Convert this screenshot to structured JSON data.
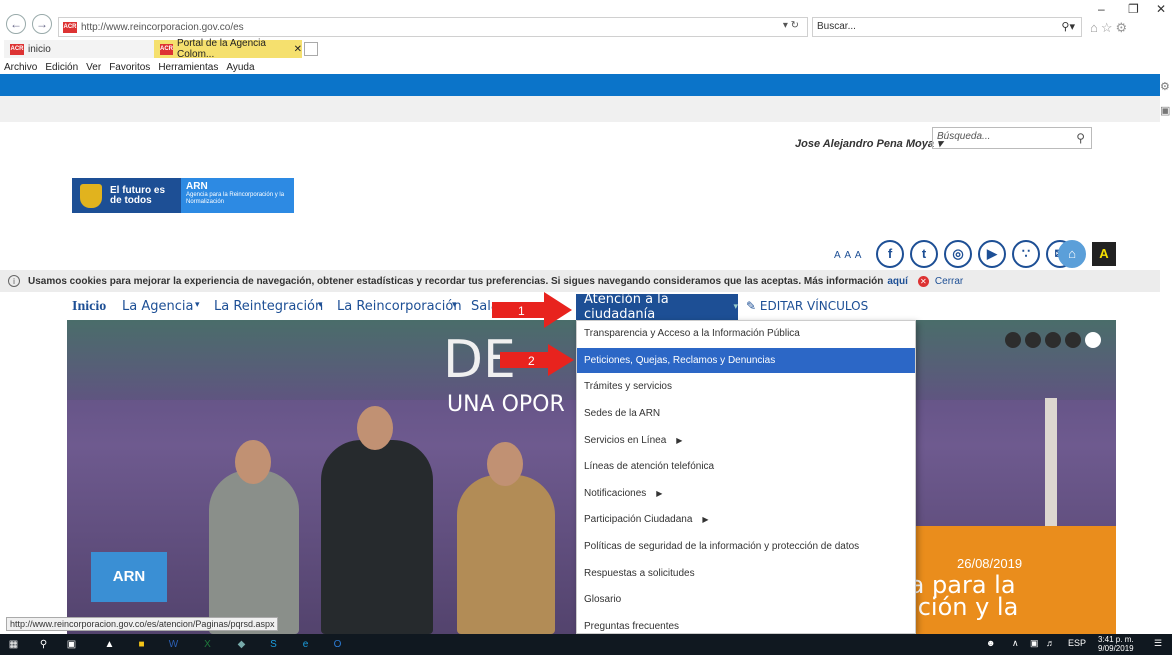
{
  "browser": {
    "url": "http://www.reincorporacion.gov.co/es",
    "favicon_text": "ACR",
    "search_placeholder": "Buscar...",
    "tabs": [
      {
        "label": "inicio"
      },
      {
        "label": "Portal de la Agencia Colom..."
      }
    ],
    "menu": [
      "Archivo",
      "Edición",
      "Ver",
      "Favoritos",
      "Herramientas",
      "Ayuda"
    ],
    "status_url": "http://www.reincorporacion.gov.co/es/atencion/Paginas/pqrsd.aspx"
  },
  "site": {
    "user_name": "Jose Alejandro Pena Moya",
    "search_placeholder": "Búsqueda...",
    "logo": {
      "left": "El futuro es de todos",
      "right_title": "ARN",
      "right_sub": "Agencia para la Reincorporación y la Normalización"
    },
    "font_size_label": "A A A",
    "contrast_label": "A",
    "social_icons": [
      "facebook-icon",
      "twitter-icon",
      "instagram-icon",
      "youtube-icon",
      "rss-icon",
      "email-icon",
      "home-icon"
    ],
    "cookie": {
      "text": "Usamos cookies para mejorar la experiencia de navegación, obtener estadísticas y recordar tus preferencias. Si sigues navegando consideramos que las aceptas. Más información",
      "link": "aquí",
      "close": "Cerrar"
    },
    "nav": {
      "home": "Inicio",
      "items": [
        "La Agencia",
        "La Reintegración",
        "La Reincorporación",
        "Sala"
      ],
      "active": "Atención a la ciudadanía",
      "edit": "EDITAR VÍNCULOS"
    },
    "dropdown": [
      {
        "label": "Transparencia y Acceso a la Información Pública",
        "submenu": false,
        "selected": false
      },
      {
        "label": "Peticiones, Quejas, Reclamos y Denuncias",
        "submenu": false,
        "selected": true
      },
      {
        "label": "Trámites y servicios",
        "submenu": false,
        "selected": false
      },
      {
        "label": "Sedes de la ARN",
        "submenu": false,
        "selected": false
      },
      {
        "label": "Servicios en Línea",
        "submenu": true,
        "selected": false
      },
      {
        "label": "Líneas de atención telefónica",
        "submenu": false,
        "selected": false
      },
      {
        "label": "Notificaciones",
        "submenu": true,
        "selected": false
      },
      {
        "label": "Participación Ciudadana",
        "submenu": true,
        "selected": false
      },
      {
        "label": "Políticas de seguridad de la información y protección de datos",
        "submenu": false,
        "selected": false
      },
      {
        "label": "Respuestas a solicitudes",
        "submenu": false,
        "selected": false
      },
      {
        "label": "Glosario",
        "submenu": false,
        "selected": false
      },
      {
        "label": "Preguntas frecuentes",
        "submenu": false,
        "selected": false
      }
    ],
    "hero": {
      "title": "DE",
      "subtitle": "UNA OPOR",
      "screen_label": "ARN",
      "date": "26/08/2019",
      "overlay_lines": [
        "ia para la",
        "ación y la"
      ]
    }
  },
  "annotations": [
    {
      "label": "1",
      "color": "#e8231e"
    },
    {
      "label": "2",
      "color": "#e8231e"
    }
  ],
  "taskbar": {
    "lang": "ESP",
    "time": "3:41 p. m.",
    "date": "9/09/2019"
  },
  "colors": {
    "brand_blue": "#1d4f95",
    "top_bar": "#0b74c9",
    "selected_item": "#2c67c6",
    "accent_orange": "#ea8d1c"
  }
}
